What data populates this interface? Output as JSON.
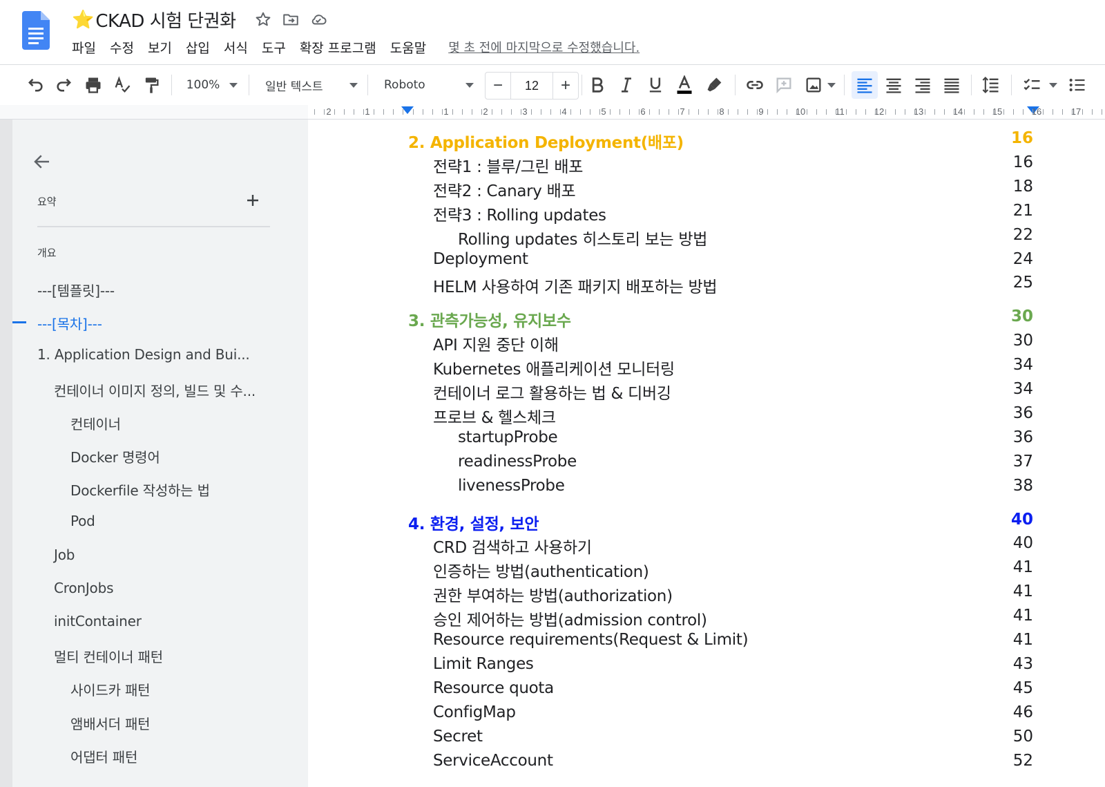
{
  "header": {
    "title_emoji": "⭐",
    "title": "CKAD 시험 단권화",
    "menus": [
      "파일",
      "수정",
      "보기",
      "삽입",
      "서식",
      "도구",
      "확장 프로그램",
      "도움말"
    ],
    "last_edit": "몇 초 전에 마지막으로 수정했습니다."
  },
  "toolbar": {
    "zoom": "100%",
    "style": "일반 텍스트",
    "font": "Roboto",
    "font_size": "12",
    "minus": "−",
    "plus": "+"
  },
  "ruler": {
    "left_numbers": [
      "2",
      "1"
    ],
    "numbers": [
      "1",
      "2",
      "3",
      "4",
      "5",
      "6",
      "7",
      "8",
      "9",
      "10",
      "11",
      "12",
      "13",
      "14",
      "15",
      "16",
      "17"
    ]
  },
  "sidebar": {
    "summary_label": "요약",
    "outline_label": "개요",
    "items": [
      {
        "label": "---[템플릿]---",
        "level": 0,
        "active": false
      },
      {
        "label": "---[목차]---",
        "level": 0,
        "active": true
      },
      {
        "label": "1. Application Design and Bui...",
        "level": 0,
        "active": false
      },
      {
        "label": "컨테이너 이미지 정의, 빌드 및 수...",
        "level": 1,
        "active": false
      },
      {
        "label": "컨테이너",
        "level": 2,
        "active": false
      },
      {
        "label": "Docker 명령어",
        "level": 2,
        "active": false
      },
      {
        "label": "Dockerfile 작성하는 법",
        "level": 2,
        "active": false
      },
      {
        "label": "Pod",
        "level": 2,
        "active": false
      },
      {
        "label": "Job",
        "level": 1,
        "active": false
      },
      {
        "label": "CronJobs",
        "level": 1,
        "active": false
      },
      {
        "label": "initContainer",
        "level": 1,
        "active": false
      },
      {
        "label": "멀티 컨테이너 패턴",
        "level": 1,
        "active": false
      },
      {
        "label": "사이드카 패턴",
        "level": 2,
        "active": false
      },
      {
        "label": "앰배서더 패턴",
        "level": 2,
        "active": false
      },
      {
        "label": "어댑터 패턴",
        "level": 2,
        "active": false
      }
    ]
  },
  "toc": [
    {
      "title": "2. Application Deployment(배포)",
      "page": "16",
      "level": 0,
      "color": "#f4b400"
    },
    {
      "title": "전략1 : 블루/그린 배포",
      "page": "16",
      "level": 1
    },
    {
      "title": "전략2 : Canary 배포",
      "page": "18",
      "level": 1
    },
    {
      "title": "전략3 : Rolling updates",
      "page": "21",
      "level": 1
    },
    {
      "title": "Rolling updates 히스토리 보는 방법",
      "page": "22",
      "level": 2
    },
    {
      "title": "Deployment",
      "page": "24",
      "level": 1
    },
    {
      "title": "HELM 사용하여 기존 패키지 배포하는 방법",
      "page": "25",
      "level": 1
    },
    {
      "title": "3. 관측가능성, 유지보수",
      "page": "30",
      "level": 0,
      "color": "#6aa84f"
    },
    {
      "title": "API 지원 중단 이해",
      "page": "30",
      "level": 1
    },
    {
      "title": "Kubernetes 애플리케이션 모니터링",
      "page": "34",
      "level": 1
    },
    {
      "title": "컨테이너 로그 활용하는 법 & 디버깅",
      "page": "34",
      "level": 1
    },
    {
      "title": "프로브 & 헬스체크",
      "page": "36",
      "level": 1
    },
    {
      "title": "startupProbe",
      "page": "36",
      "level": 2
    },
    {
      "title": "readinessProbe",
      "page": "37",
      "level": 2
    },
    {
      "title": "livenessProbe",
      "page": "38",
      "level": 2
    },
    {
      "title": "4. 환경, 설정, 보안",
      "page": "40",
      "level": 0,
      "color": "#0b1ff0"
    },
    {
      "title": "CRD 검색하고 사용하기",
      "page": "40",
      "level": 1
    },
    {
      "title": "인증하는 방법(authentication)",
      "page": "41",
      "level": 1
    },
    {
      "title": "권한 부여하는 방법(authorization)",
      "page": "41",
      "level": 1
    },
    {
      "title": "승인 제어하는 방법(admission control)",
      "page": "41",
      "level": 1
    },
    {
      "title": "Resource requirements(Request & Limit)",
      "page": "41",
      "level": 1
    },
    {
      "title": "Limit Ranges",
      "page": "43",
      "level": 1
    },
    {
      "title": "Resource quota",
      "page": "45",
      "level": 1
    },
    {
      "title": "ConfigMap",
      "page": "46",
      "level": 1
    },
    {
      "title": "Secret",
      "page": "50",
      "level": 1
    },
    {
      "title": "ServiceAccount",
      "page": "52",
      "level": 1
    }
  ],
  "colors": {
    "accent": "#1a73e8",
    "docs_blue": "#4285f4"
  }
}
